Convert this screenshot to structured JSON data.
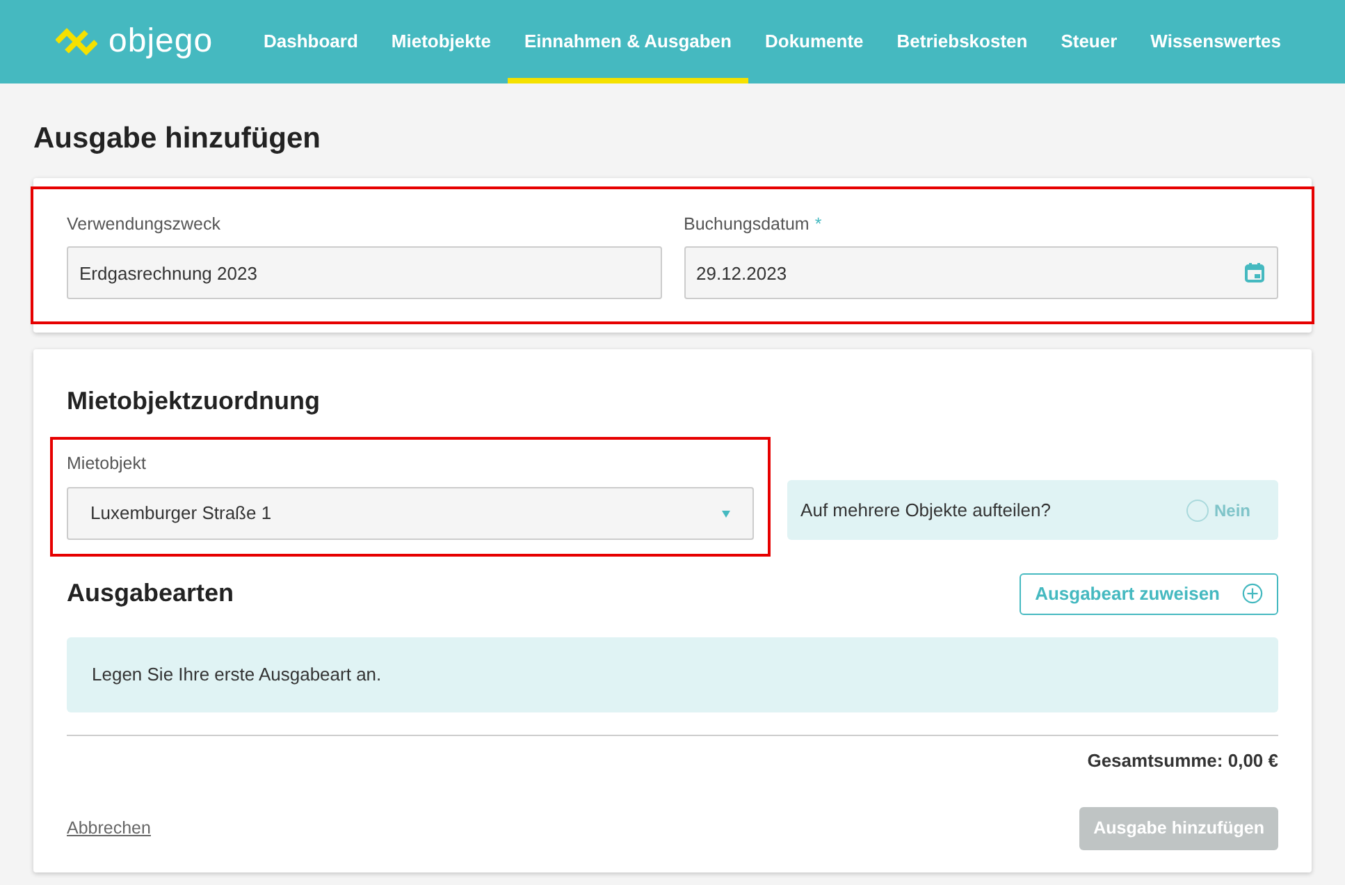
{
  "brand": {
    "name": "objego"
  },
  "nav": [
    {
      "label": "Dashboard",
      "selected": false
    },
    {
      "label": "Mietobjekte",
      "selected": false
    },
    {
      "label": "Einnahmen & Ausgaben",
      "selected": true
    },
    {
      "label": "Dokumente",
      "selected": false
    },
    {
      "label": "Betriebskosten",
      "selected": false
    },
    {
      "label": "Steuer",
      "selected": false
    },
    {
      "label": "Wissenswertes",
      "selected": false
    }
  ],
  "page_title": "Ausgabe hinzufügen",
  "basics": {
    "highlighted": true,
    "fields": [
      {
        "label": "Verwendungszweck",
        "value": "Erdgasrechnung 2023",
        "kind": "text"
      },
      {
        "label": "Buchungsdatum",
        "value": "29.12.2023",
        "required_mark": "*",
        "kind": "date"
      }
    ]
  },
  "assignment": {
    "title": "Mietobjektzuordnung",
    "property": {
      "label": "Mietobjekt",
      "value": "Luxemburger Straße 1",
      "highlighted": true
    },
    "split": {
      "question": "Auf mehrere Objekte aufteilen?",
      "toggle_label": "Nein",
      "on": false,
      "disabled": true
    }
  },
  "expense_types": {
    "title": "Ausgabearten",
    "add_button": "Ausgabeart zuweisen",
    "empty_message": "Legen Sie Ihre erste Ausgabeart an.",
    "total": "Gesamtsumme: 0,00 €"
  },
  "actions": {
    "cancel": "Abbrechen",
    "submit": "Ausgabe hinzufügen",
    "submit_disabled": true
  }
}
